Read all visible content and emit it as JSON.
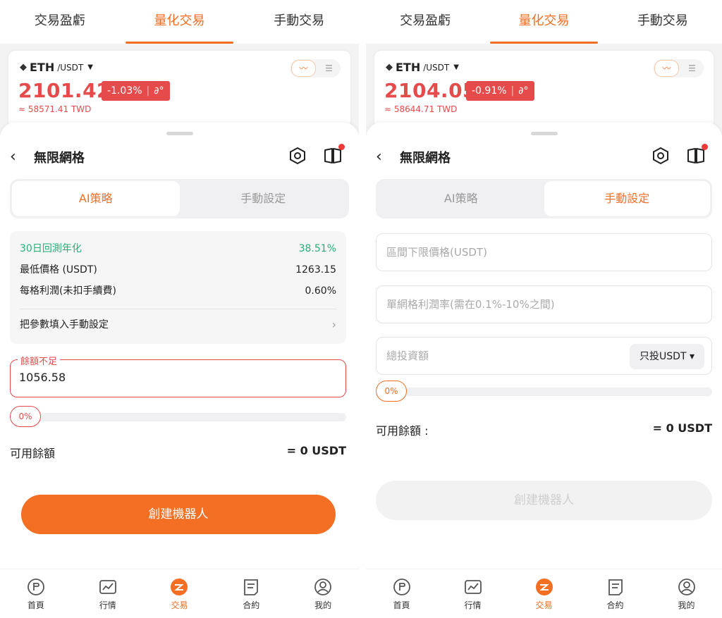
{
  "colors": {
    "accent": "#f26f24",
    "down": "#e54b4b",
    "positive": "#27ae76"
  },
  "top_tabs": [
    "交易盈虧",
    "量化交易",
    "手動交易"
  ],
  "active_top_tab": "量化交易",
  "left": {
    "ticker": {
      "base": "ETH",
      "quote": "/USDT",
      "price": "2101.42",
      "change": "-1.03%",
      "fiat": "≈ 58571.41 TWD"
    },
    "sheet_title": "無限網格",
    "segments": [
      "AI策略",
      "手動設定"
    ],
    "active_segment": "AI策略",
    "summary": {
      "rows": [
        {
          "label": "30日回測年化",
          "value": "38.51%"
        },
        {
          "label": "最低價格 (USDT)",
          "value": "1263.15"
        },
        {
          "label": "每格利潤(未扣手續費)",
          "value": "0.60%"
        }
      ],
      "fill_label": "把參數填入手動設定"
    },
    "amount": {
      "legend": "餘額不足",
      "value": "1056.58"
    },
    "progress": {
      "percent": 0,
      "label": "0%"
    },
    "available": {
      "label": "可用餘額",
      "value": "= 0 USDT"
    },
    "create_label": "創建機器人"
  },
  "right": {
    "ticker": {
      "base": "ETH",
      "quote": "/USDT",
      "price": "2104.05",
      "change": "-0.91%",
      "fiat": "≈ 58644.71 TWD"
    },
    "sheet_title": "無限網格",
    "segments": [
      "AI策略",
      "手動設定"
    ],
    "active_segment": "手動設定",
    "fields": {
      "lower_price_placeholder": "區間下限價格(USDT)",
      "grid_profit_placeholder": "單網格利潤率(需在0.1%-10%之間)",
      "total_invest_placeholder": "總投資額",
      "unit_label": "只投USDT ▾"
    },
    "progress": {
      "percent": 0,
      "label": "0%"
    },
    "available": {
      "label": "可用餘額 :",
      "value": "= 0 USDT"
    },
    "create_label": "創建機器人"
  },
  "nav": [
    "首頁",
    "行情",
    "交易",
    "合約",
    "我的"
  ],
  "active_nav": "交易"
}
